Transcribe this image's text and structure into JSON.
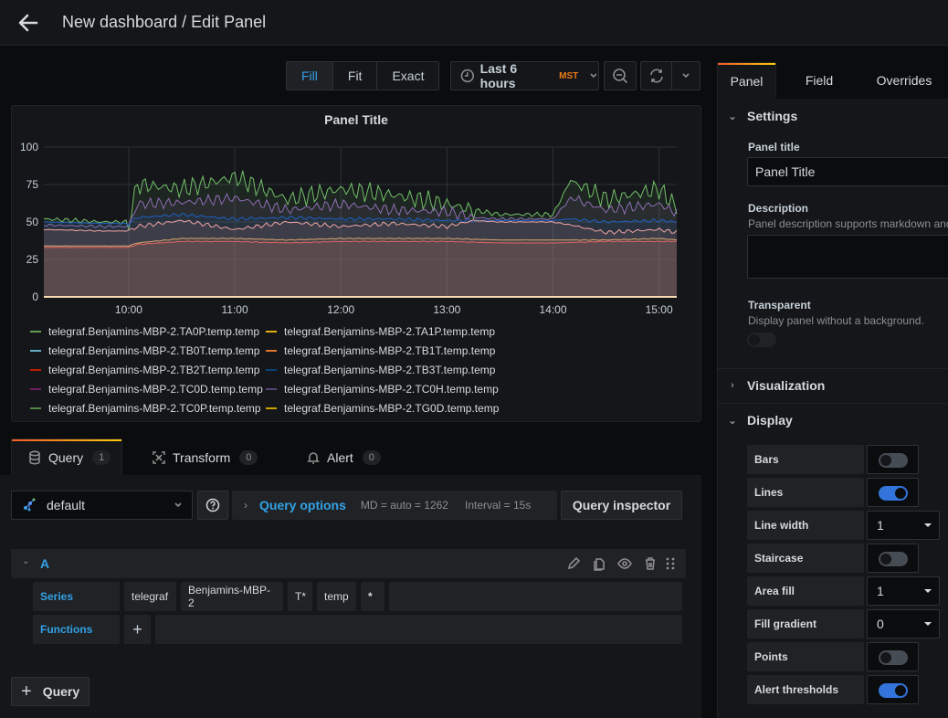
{
  "header": {
    "title": "New dashboard / Edit Panel"
  },
  "toolbar": {
    "display_modes": [
      {
        "label": "Fill",
        "active": true
      },
      {
        "label": "Fit",
        "active": false
      },
      {
        "label": "Exact",
        "active": false
      }
    ],
    "time_range": "Last 6 hours",
    "timezone": "MST"
  },
  "panel": {
    "title": "Panel Title",
    "legend": [
      {
        "name": "telegraf.Benjamins-MBP-2.TA0P.temp.temp",
        "color": "#629e51"
      },
      {
        "name": "telegraf.Benjamins-MBP-2.TA1P.temp.temp",
        "color": "#e5ac0e"
      },
      {
        "name": "telegraf.Benjamins-MBP-2.TB0T.temp.temp",
        "color": "#64b0c8"
      },
      {
        "name": "telegraf.Benjamins-MBP-2.TB1T.temp.temp",
        "color": "#e0752d"
      },
      {
        "name": "telegraf.Benjamins-MBP-2.TB2T.temp.temp",
        "color": "#bf1b00"
      },
      {
        "name": "telegraf.Benjamins-MBP-2.TB3T.temp.temp",
        "color": "#0a437c"
      },
      {
        "name": "telegraf.Benjamins-MBP-2.TC0D.temp.temp",
        "color": "#6d1f62"
      },
      {
        "name": "telegraf.Benjamins-MBP-2.TC0H.temp.temp",
        "color": "#584477"
      },
      {
        "name": "telegraf.Benjamins-MBP-2.TC0P.temp.temp",
        "color": "#508642"
      },
      {
        "name": "telegraf.Benjamins-MBP-2.TG0D.temp.temp",
        "color": "#cca300"
      }
    ]
  },
  "chart_data": {
    "type": "area",
    "title": "Panel Title",
    "xlabel": "",
    "ylabel": "",
    "x_ticks": [
      "10:00",
      "11:00",
      "12:00",
      "13:00",
      "14:00",
      "15:00"
    ],
    "y_ticks": [
      0,
      25,
      50,
      75,
      100
    ],
    "ylim": [
      0,
      100
    ],
    "x_range": [
      "09:12",
      "15:10"
    ],
    "grid": true,
    "legend_position": "bottom",
    "series": [
      {
        "name": "TC0P (green, spiky)",
        "color": "#73bf69",
        "x": [
          "09:12",
          "09:45",
          "10:00",
          "10:05",
          "10:30",
          "11:00",
          "11:30",
          "12:00",
          "12:30",
          "13:00",
          "13:15",
          "13:30",
          "14:00",
          "14:10",
          "14:30",
          "15:00",
          "15:10"
        ],
        "values": [
          52,
          50,
          50,
          75,
          72,
          80,
          65,
          72,
          68,
          62,
          58,
          55,
          55,
          78,
          65,
          72,
          60
        ]
      },
      {
        "name": "TC0H (purple)",
        "color": "#8f6db5",
        "x": [
          "09:12",
          "09:45",
          "10:00",
          "10:05",
          "10:30",
          "11:00",
          "11:30",
          "12:00",
          "12:30",
          "13:00",
          "13:15",
          "13:30",
          "14:00",
          "14:10",
          "14:30",
          "15:00",
          "15:10"
        ],
        "values": [
          48,
          47,
          47,
          62,
          63,
          66,
          58,
          62,
          58,
          57,
          53,
          52,
          52,
          66,
          58,
          62,
          56
        ]
      },
      {
        "name": "TB3T (blue)",
        "color": "#1f60c4",
        "x": [
          "09:12",
          "09:45",
          "10:00",
          "10:05",
          "10:30",
          "11:00",
          "11:30",
          "12:00",
          "12:30",
          "13:00",
          "13:15",
          "13:30",
          "14:00",
          "14:10",
          "14:30",
          "15:00",
          "15:10"
        ],
        "values": [
          50,
          49,
          49,
          53,
          55,
          52,
          53,
          52,
          52,
          51,
          51,
          51,
          51,
          52,
          50,
          51,
          50
        ]
      },
      {
        "name": "TB2T (pink)",
        "color": "#f2a5a5",
        "x": [
          "09:12",
          "09:45",
          "10:00",
          "10:05",
          "10:30",
          "11:00",
          "11:30",
          "12:00",
          "12:30",
          "13:00",
          "13:15",
          "13:30",
          "14:00",
          "14:10",
          "14:30",
          "15:00",
          "15:10"
        ],
        "values": [
          45,
          44,
          44,
          47,
          51,
          45,
          50,
          47,
          49,
          47,
          51,
          50,
          50,
          48,
          43,
          45,
          43
        ]
      },
      {
        "name": "TB1T (tan)",
        "color": "#d6a36e",
        "x": [
          "09:12",
          "09:45",
          "10:00",
          "10:05",
          "10:30",
          "11:00",
          "11:30",
          "12:00",
          "12:30",
          "13:00",
          "13:30",
          "14:00",
          "14:30",
          "15:00",
          "15:10"
        ],
        "values": [
          34,
          34,
          34,
          36,
          39,
          39,
          38,
          39,
          39,
          39,
          38,
          38,
          38,
          39,
          38
        ]
      },
      {
        "name": "TB0T (red)",
        "color": "#e06666",
        "x": [
          "09:12",
          "09:45",
          "10:00",
          "10:05",
          "10:30",
          "11:00",
          "11:30",
          "12:00",
          "12:30",
          "13:00",
          "13:30",
          "14:00",
          "14:30",
          "15:00",
          "15:10"
        ],
        "values": [
          33,
          33,
          33,
          35,
          37,
          37,
          36,
          37,
          37,
          37,
          36,
          36,
          37,
          37,
          37
        ]
      },
      {
        "name": "TG0D (baseline)",
        "color": "#f9dcb2",
        "x": [
          "09:12",
          "15:10"
        ],
        "values": [
          0,
          0
        ]
      }
    ]
  },
  "query_tabs": [
    {
      "label": "Query",
      "count": "1",
      "icon": "database-icon",
      "active": true
    },
    {
      "label": "Transform",
      "count": "0",
      "icon": "transform-icon",
      "active": false
    },
    {
      "label": "Alert",
      "count": "0",
      "icon": "bell-icon",
      "active": false
    }
  ],
  "query": {
    "datasource": "default",
    "options_label": "Query options",
    "md": "MD = auto = 1262",
    "interval": "Interval = 15s",
    "inspector_label": "Query inspector",
    "ref_id": "A",
    "series_label": "Series",
    "series_segments": [
      "telegraf",
      "Benjamins-MBP-2",
      "T*",
      "temp",
      "*"
    ],
    "functions_label": "Functions",
    "add_function": "+",
    "add_query_label": "Query"
  },
  "options_tabs": [
    {
      "label": "Panel",
      "active": true
    },
    {
      "label": "Field",
      "active": false
    },
    {
      "label": "Overrides",
      "active": false
    }
  ],
  "settings": {
    "section_label": "Settings",
    "panel_title_label": "Panel title",
    "panel_title_value": "Panel Title",
    "description_label": "Description",
    "description_help": "Panel description supports markdown and links.",
    "description_value": "",
    "transparent_label": "Transparent",
    "transparent_help": "Display panel without a background.",
    "transparent": false
  },
  "visualization": {
    "section_label": "Visualization"
  },
  "display": {
    "section_label": "Display",
    "rows": [
      {
        "label": "Bars",
        "type": "toggle",
        "value": false
      },
      {
        "label": "Lines",
        "type": "toggle",
        "value": true
      },
      {
        "label": "Line width",
        "type": "select",
        "value": "1"
      },
      {
        "label": "Staircase",
        "type": "toggle",
        "value": false
      },
      {
        "label": "Area fill",
        "type": "select",
        "value": "1"
      },
      {
        "label": "Fill gradient",
        "type": "select",
        "value": "0"
      },
      {
        "label": "Points",
        "type": "toggle",
        "value": false
      },
      {
        "label": "Alert thresholds",
        "type": "toggle",
        "value": true
      }
    ]
  }
}
